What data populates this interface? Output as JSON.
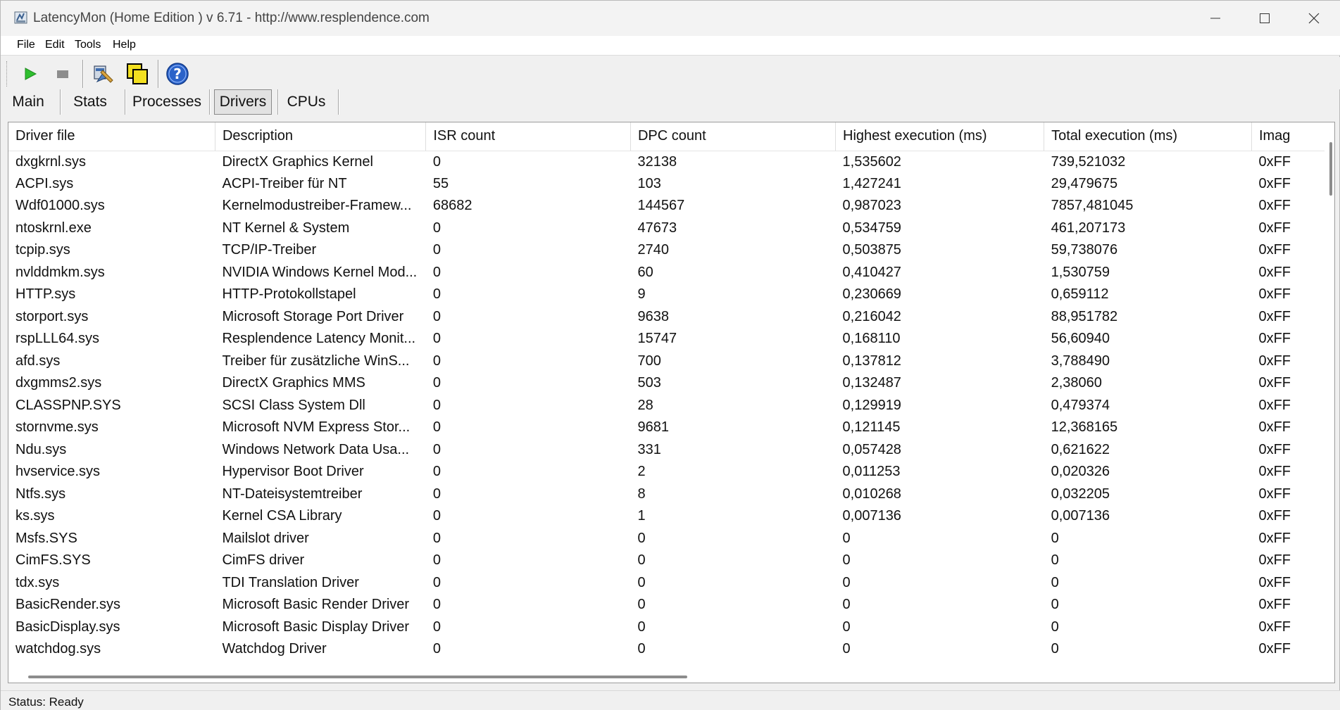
{
  "window": {
    "title": "LatencyMon  (Home Edition )  v 6.71 - http://www.resplendence.com"
  },
  "menu": {
    "file": "File",
    "edit": "Edit",
    "tools": "Tools",
    "help": "Help"
  },
  "toolbar": {
    "buttons": [
      "play-icon",
      "stop-icon",
      "tools-icon",
      "copy-icon",
      "help-icon"
    ]
  },
  "tabs": [
    {
      "label": "Main"
    },
    {
      "label": "Stats"
    },
    {
      "label": "Processes"
    },
    {
      "label": "Drivers",
      "active": true
    },
    {
      "label": "CPUs"
    }
  ],
  "grid": {
    "columns": [
      "Driver file",
      "Description",
      "ISR count",
      "DPC count",
      "Highest execution (ms)",
      "Total execution (ms)",
      "Imag"
    ],
    "rows": [
      [
        "dxgkrnl.sys",
        "DirectX Graphics Kernel",
        "0",
        "32138",
        "1,535602",
        "739,521032",
        "0xFF"
      ],
      [
        "ACPI.sys",
        "ACPI-Treiber für NT",
        "55",
        "103",
        "1,427241",
        "29,479675",
        "0xFF"
      ],
      [
        "Wdf01000.sys",
        "Kernelmodustreiber-Framew...",
        "68682",
        "144567",
        "0,987023",
        "7857,481045",
        "0xFF"
      ],
      [
        "ntoskrnl.exe",
        "NT Kernel & System",
        "0",
        "47673",
        "0,534759",
        "461,207173",
        "0xFF"
      ],
      [
        "tcpip.sys",
        "TCP/IP-Treiber",
        "0",
        "2740",
        "0,503875",
        "59,738076",
        "0xFF"
      ],
      [
        "nvlddmkm.sys",
        "NVIDIA Windows Kernel Mod...",
        "0",
        "60",
        "0,410427",
        "1,530759",
        "0xFF"
      ],
      [
        "HTTP.sys",
        "HTTP-Protokollstapel",
        "0",
        "9",
        "0,230669",
        "0,659112",
        "0xFF"
      ],
      [
        "storport.sys",
        "Microsoft Storage Port Driver",
        "0",
        "9638",
        "0,216042",
        "88,951782",
        "0xFF"
      ],
      [
        "rspLLL64.sys",
        "Resplendence Latency Monit...",
        "0",
        "15747",
        "0,168110",
        "56,60940",
        "0xFF"
      ],
      [
        "afd.sys",
        "Treiber für zusätzliche WinS...",
        "0",
        "700",
        "0,137812",
        "3,788490",
        "0xFF"
      ],
      [
        "dxgmms2.sys",
        "DirectX Graphics MMS",
        "0",
        "503",
        "0,132487",
        "2,38060",
        "0xFF"
      ],
      [
        "CLASSPNP.SYS",
        "SCSI Class System Dll",
        "0",
        "28",
        "0,129919",
        "0,479374",
        "0xFF"
      ],
      [
        "stornvme.sys",
        "Microsoft NVM Express Stor...",
        "0",
        "9681",
        "0,121145",
        "12,368165",
        "0xFF"
      ],
      [
        "Ndu.sys",
        "Windows Network Data Usa...",
        "0",
        "331",
        "0,057428",
        "0,621622",
        "0xFF"
      ],
      [
        "hvservice.sys",
        "Hypervisor Boot Driver",
        "0",
        "2",
        "0,011253",
        "0,020326",
        "0xFF"
      ],
      [
        "Ntfs.sys",
        "NT-Dateisystemtreiber",
        "0",
        "8",
        "0,010268",
        "0,032205",
        "0xFF"
      ],
      [
        "ks.sys",
        "Kernel CSA Library",
        "0",
        "1",
        "0,007136",
        "0,007136",
        "0xFF"
      ],
      [
        "Msfs.SYS",
        "Mailslot driver",
        "0",
        "0",
        "0",
        "0",
        "0xFF"
      ],
      [
        "CimFS.SYS",
        "CimFS driver",
        "0",
        "0",
        "0",
        "0",
        "0xFF"
      ],
      [
        "tdx.sys",
        "TDI Translation Driver",
        "0",
        "0",
        "0",
        "0",
        "0xFF"
      ],
      [
        "BasicRender.sys",
        "Microsoft Basic Render Driver",
        "0",
        "0",
        "0",
        "0",
        "0xFF"
      ],
      [
        "BasicDisplay.sys",
        "Microsoft Basic Display Driver",
        "0",
        "0",
        "0",
        "0",
        "0xFF"
      ],
      [
        "watchdog.sys",
        "Watchdog Driver",
        "0",
        "0",
        "0",
        "0",
        "0xFF"
      ]
    ]
  },
  "status": {
    "text": "Status: Ready"
  }
}
